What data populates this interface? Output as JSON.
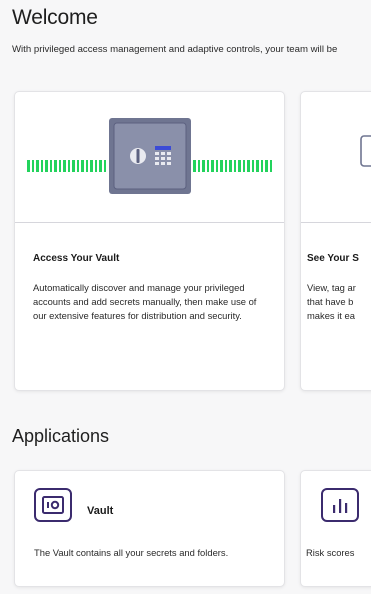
{
  "welcome": {
    "title": "Welcome",
    "subtitle": "With privileged access management and adaptive controls, your team will be"
  },
  "feature_cards": [
    {
      "heading": "Access Your Vault",
      "description": "Automatically discover and manage your privileged accounts and add secrets manually, then make use of our extensive features for distribution and security.",
      "icon": "vault-safe-icon"
    },
    {
      "heading": "See Your S",
      "description_lines": [
        "View, tag ar",
        "that have b",
        "makes it ea"
      ],
      "icon": "partial-device-icon"
    }
  ],
  "applications": {
    "title": "Applications",
    "items": [
      {
        "name": "Vault",
        "description": "The Vault contains all your secrets and folders.",
        "icon": "vault-app-icon"
      },
      {
        "name": "",
        "description": "Risk scores",
        "icon": "bar-chart-icon"
      }
    ]
  },
  "colors": {
    "accent_purple": "#3b2b6e",
    "signal_green": "#22d35c",
    "safe_gray": "#6f7591",
    "page_bg": "#f7f7f8"
  }
}
